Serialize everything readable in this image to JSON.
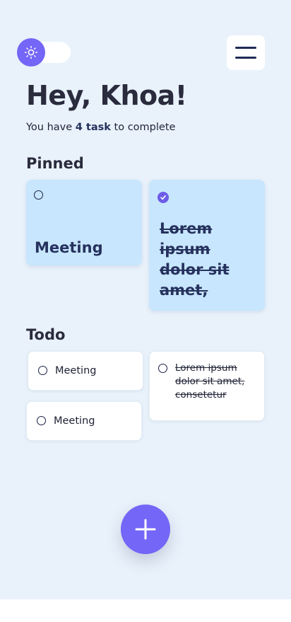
{
  "header": {
    "greeting": "Hey, Khoa!",
    "subtitle_prefix": "You have ",
    "task_count": "4 task",
    "subtitle_suffix": " to complete",
    "theme_icon": "sun-icon",
    "menu_icon": "hamburger-menu-icon",
    "theme_toggle": {
      "state": "off"
    }
  },
  "pinned": {
    "title": "Pinned",
    "items": [
      {
        "label": "Meeting",
        "completed": false
      },
      {
        "label": "Lorem ipsum dolor sit amet,",
        "completed": true
      }
    ]
  },
  "todo": {
    "title": "Todo",
    "items": [
      {
        "label": "Meeting",
        "completed": false
      },
      {
        "label": "Lorem ipsum dolor sit amet, consetetur",
        "completed": true
      },
      {
        "label": "Meeting",
        "completed": false
      }
    ]
  },
  "fab": {
    "icon": "plus-icon"
  },
  "colors": {
    "background": "#e9f2fb",
    "accent": "#7466f6",
    "pinned_card": "#c8e6fd",
    "todo_card": "#ffffff",
    "text_dark": "#26325e"
  }
}
